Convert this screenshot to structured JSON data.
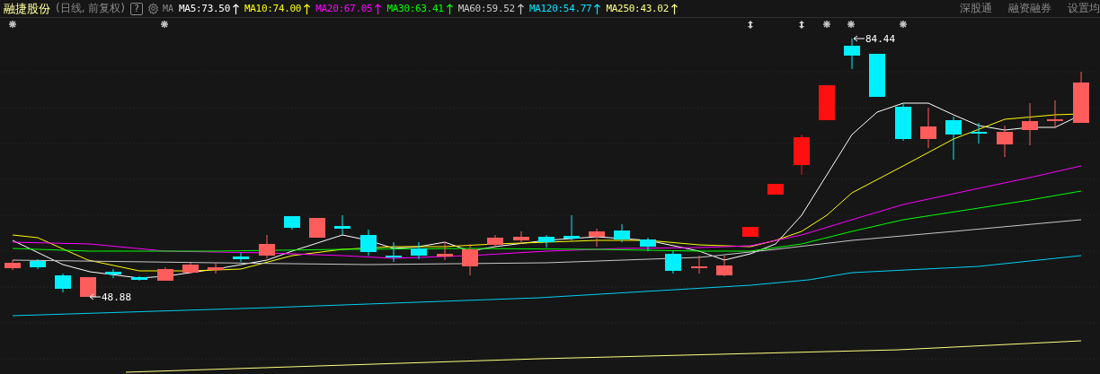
{
  "header": {
    "title": "融捷股份",
    "subtitle": "(日线, 前复权)",
    "help": "?",
    "ma_label": "MA",
    "moving_averages": [
      {
        "label": "MA5:73.50",
        "color": "#ffffff"
      },
      {
        "label": "MA10:74.00",
        "color": "#ffff00"
      },
      {
        "label": "MA20:67.05",
        "color": "#ff00ff"
      },
      {
        "label": "MA30:63.41",
        "color": "#00ff00"
      },
      {
        "label": "MA60:59.52",
        "color": "#c8c8c8"
      },
      {
        "label": "MA120:54.77",
        "color": "#00e5ff"
      },
      {
        "label": "MA250:43.02",
        "color": "#ffff80"
      }
    ],
    "links": [
      {
        "label": "深股通"
      },
      {
        "label": "融资融券"
      },
      {
        "label": "设置均"
      }
    ]
  },
  "price_marks": [
    {
      "kind": "high",
      "label": "84.44"
    },
    {
      "kind": "low",
      "label": "48.88"
    }
  ]
}
